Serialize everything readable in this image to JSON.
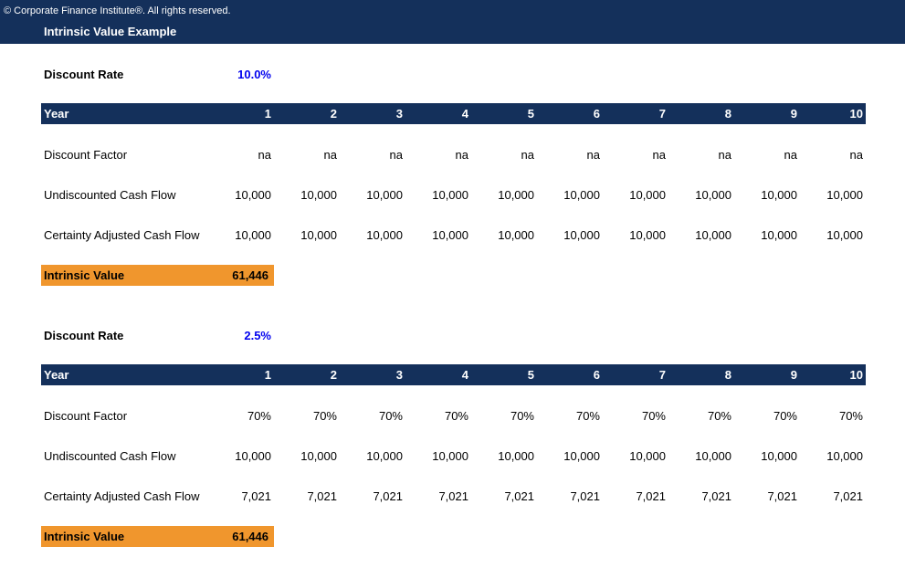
{
  "header": {
    "copyright": "© Corporate Finance Institute®. All rights reserved.",
    "title": "Intrinsic Value Example"
  },
  "colors": {
    "header_bg": "#14305b",
    "intrinsic_bg": "#f0962d",
    "rate_text": "#0000ee"
  },
  "sections": [
    {
      "discount_rate_label": "Discount Rate",
      "discount_rate": "10.0%",
      "year_label": "Year",
      "years": [
        "1",
        "2",
        "3",
        "4",
        "5",
        "6",
        "7",
        "8",
        "9",
        "10"
      ],
      "rows": [
        {
          "label": "Discount Factor",
          "values": [
            "na",
            "na",
            "na",
            "na",
            "na",
            "na",
            "na",
            "na",
            "na",
            "na"
          ]
        },
        {
          "label": "Undiscounted Cash Flow",
          "values": [
            "10,000",
            "10,000",
            "10,000",
            "10,000",
            "10,000",
            "10,000",
            "10,000",
            "10,000",
            "10,000",
            "10,000"
          ]
        },
        {
          "label": "Certainty Adjusted Cash Flow",
          "values": [
            "10,000",
            "10,000",
            "10,000",
            "10,000",
            "10,000",
            "10,000",
            "10,000",
            "10,000",
            "10,000",
            "10,000"
          ]
        }
      ],
      "intrinsic_label": "Intrinsic Value",
      "intrinsic_value": "61,446"
    },
    {
      "discount_rate_label": "Discount Rate",
      "discount_rate": "2.5%",
      "year_label": "Year",
      "years": [
        "1",
        "2",
        "3",
        "4",
        "5",
        "6",
        "7",
        "8",
        "9",
        "10"
      ],
      "rows": [
        {
          "label": "Discount Factor",
          "values": [
            "70%",
            "70%",
            "70%",
            "70%",
            "70%",
            "70%",
            "70%",
            "70%",
            "70%",
            "70%"
          ]
        },
        {
          "label": "Undiscounted Cash Flow",
          "values": [
            "10,000",
            "10,000",
            "10,000",
            "10,000",
            "10,000",
            "10,000",
            "10,000",
            "10,000",
            "10,000",
            "10,000"
          ]
        },
        {
          "label": "Certainty Adjusted Cash Flow",
          "values": [
            "7,021",
            "7,021",
            "7,021",
            "7,021",
            "7,021",
            "7,021",
            "7,021",
            "7,021",
            "7,021",
            "7,021"
          ]
        }
      ],
      "intrinsic_label": "Intrinsic Value",
      "intrinsic_value": "61,446"
    }
  ]
}
